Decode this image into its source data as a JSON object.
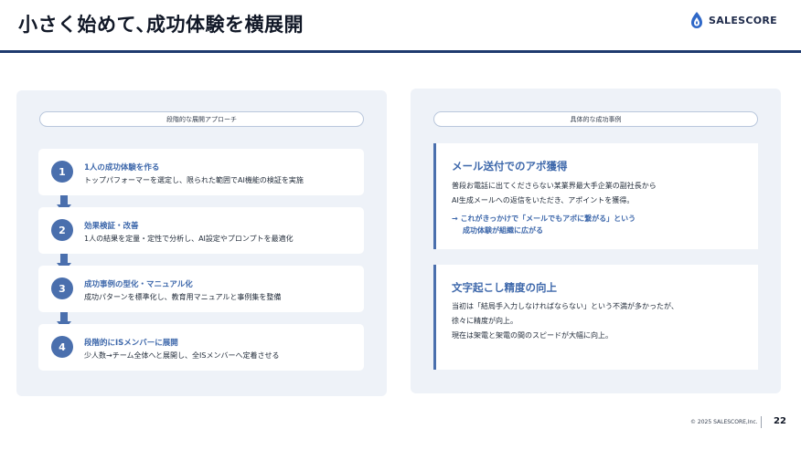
{
  "header": {
    "title": "小さく始めて､成功体験を横展開",
    "logo_text": "SALESCORE"
  },
  "left_panel": {
    "heading": "段階的な展開アプローチ",
    "steps": [
      {
        "number": "1",
        "title": "1人の成功体験を作る",
        "description": "トップパフォーマーを選定し、限られた範囲でAI機能の検証を実施"
      },
      {
        "number": "2",
        "title": "効果検証・改善",
        "description": "1人の結果を定量・定性で分析し、AI設定やプロンプトを最適化"
      },
      {
        "number": "3",
        "title": "成功事例の型化・マニュアル化",
        "description": "成功パターンを標準化し、教育用マニュアルと事例集を整備"
      },
      {
        "number": "4",
        "title": "段階的にISメンバーに展開",
        "description": "少人数→チーム全体へと展開し、全ISメンバーへ定着させる"
      }
    ]
  },
  "right_panel": {
    "heading": "具体的な成功事例",
    "cases": [
      {
        "title": "メール送付でのアポ獲得",
        "lines": [
          "普段お電話に出てくださらない某業界最大手企業の副社長から",
          "AI生成メールへの返信をいただき、アポイントを獲得。"
        ],
        "note_lines": [
          "→ これがきっかけで「メールでもアポに繋がる」という",
          "成功体験が組織に広がる"
        ]
      },
      {
        "title": "文字起こし精度の向上",
        "lines": [
          "当初は「結局手入力しなければならない」という不満が多かったが、",
          "徐々に精度が向上。",
          "現在は架電と架電の間のスピードが大幅に向上。"
        ],
        "note_lines": []
      }
    ]
  },
  "footer": {
    "copyright": "© 2025 SALESCORE,Inc.",
    "page_number": "22"
  },
  "colors": {
    "accent": "#4a6fad",
    "accent_text": "#3e68ab",
    "header_rule": "#1e3a6e",
    "panel_bg": "#eef2f8"
  }
}
